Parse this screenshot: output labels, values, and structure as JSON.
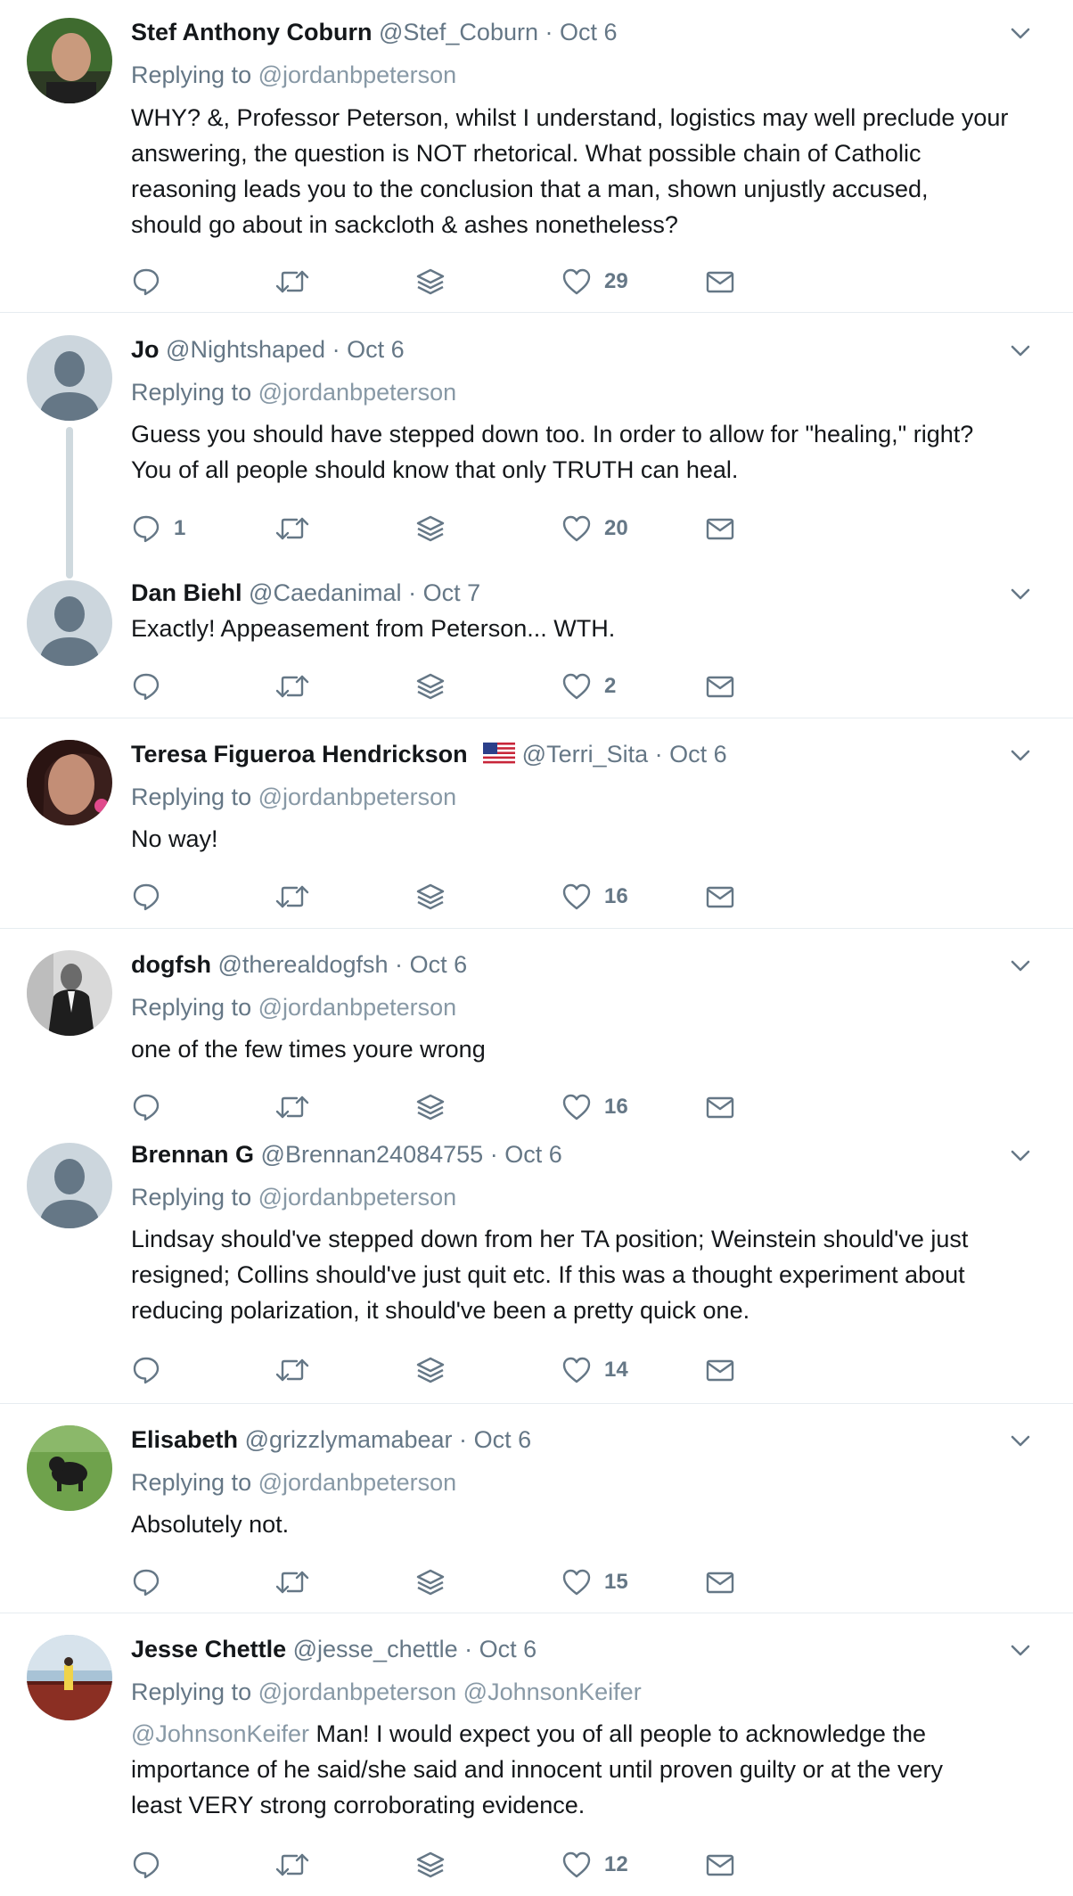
{
  "colors": {
    "icon": "#657786",
    "mention": "#8899a6",
    "divider": "#e6ecf0",
    "thread_line": "#cfd9de",
    "default_avatar_bg": "#ccd6dd",
    "default_avatar_fg": "#657786"
  },
  "tweets": [
    {
      "name": "Stef Anthony Coburn",
      "handle": "@Stef_Coburn",
      "date": "Oct 6",
      "replying_prefix": "Replying to",
      "replying_to": "@jordanbpeterson",
      "text": "WHY? &, Professor Peterson, whilst I understand, logistics may well preclude your\nanswering, the question is NOT rhetorical. What possible chain of Catholic\nreasoning leads you to the conclusion that a man, shown unjustly accused,\nshould go about in sackcloth & ashes nonetheless?",
      "reply_count": "",
      "like_count": "29",
      "avatar": "photo-man"
    },
    {
      "name": "Jo",
      "handle": "@Nightshaped",
      "date": "Oct 6",
      "replying_prefix": "Replying to",
      "replying_to": "@jordanbpeterson",
      "text": "Guess you should have stepped down too. In order to allow for \"healing,\" right?\nYou of all people should know that only TRUTH can heal.",
      "reply_count": "1",
      "like_count": "20",
      "avatar": "default-egg"
    },
    {
      "name": "Dan Biehl",
      "handle": "@Caedanimal",
      "date": "Oct 7",
      "text": "Exactly! Appeasement from Peterson... WTH.",
      "reply_count": "",
      "like_count": "2",
      "avatar": "default-egg"
    },
    {
      "name": "Teresa Figueroa Hendrickson",
      "flag": "us-flag",
      "handle": "@Terri_Sita",
      "date": "Oct 6",
      "replying_prefix": "Replying to",
      "replying_to": "@jordanbpeterson",
      "text": "No way!",
      "reply_count": "",
      "like_count": "16",
      "avatar": "photo-woman"
    },
    {
      "name": "dogfsh",
      "handle": "@therealdogfsh",
      "date": "Oct 6",
      "replying_prefix": "Replying to",
      "replying_to": "@jordanbpeterson",
      "text": "one of the few times youre wrong",
      "reply_count": "",
      "like_count": "16",
      "avatar": "photo-suit"
    },
    {
      "name": "Brennan G",
      "handle": "@Brennan24084755",
      "date": "Oct 6",
      "replying_prefix": "Replying to",
      "replying_to": "@jordanbpeterson",
      "text": "Lindsay should've stepped down from her TA position; Weinstein should've just\nresigned; Collins should've just quit etc. If this was a thought experiment about\nreducing polarization, it should've been a pretty quick one.",
      "reply_count": "",
      "like_count": "14",
      "avatar": "default-egg"
    },
    {
      "name": "Elisabeth",
      "handle": "@grizzlymamabear",
      "date": "Oct 6",
      "replying_prefix": "Replying to",
      "replying_to": "@jordanbpeterson",
      "text": "Absolutely not.",
      "reply_count": "",
      "like_count": "15",
      "avatar": "photo-dog"
    },
    {
      "name": "Jesse Chettle",
      "handle": "@jesse_chettle",
      "date": "Oct 6",
      "replying_prefix": "Replying to",
      "replying_to": "@jordanbpeterson @JohnsonKeifer",
      "text_mention": "@JohnsonKeifer",
      "text": " Man! I would expect you of all people to acknowledge the\nimportance of he said/she said and innocent until proven guilty or at the very\nleast VERY strong corroborating evidence.",
      "reply_count": "",
      "like_count": "12",
      "avatar": "photo-bridge"
    }
  ]
}
